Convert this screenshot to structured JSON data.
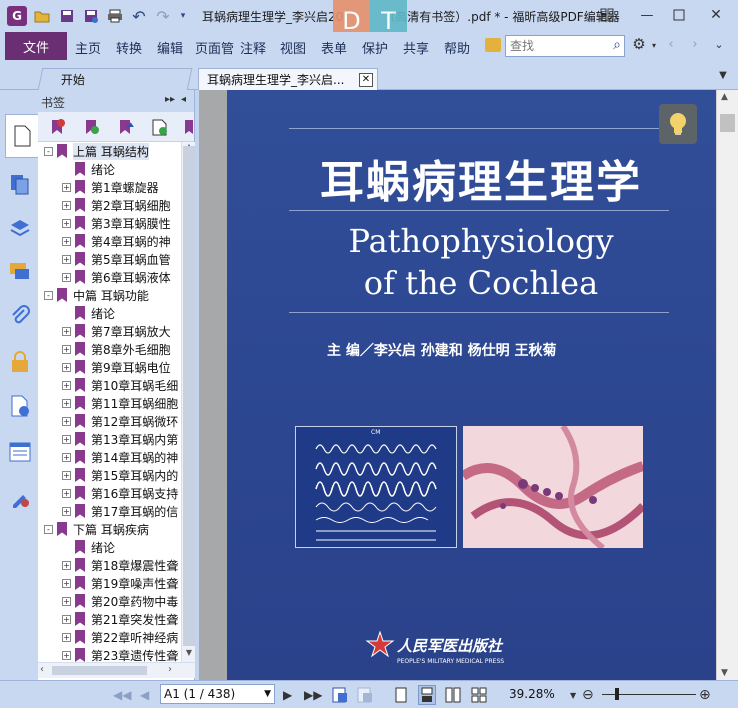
{
  "title_bar": {
    "title": "耳蜗病理生理学_李兴启20",
    "title_suffix": "（高清有书签）.pdf * - 福昕高级PDF编辑器",
    "overlay_left": "D",
    "overlay_right": "T"
  },
  "menu": {
    "file": "文件",
    "items": [
      "主页",
      "转换",
      "编辑",
      "页面管",
      "注释",
      "视图",
      "表单",
      "保护",
      "共享",
      "帮助"
    ],
    "search_placeholder": "查找"
  },
  "tabs": {
    "start": "开始",
    "doc": "耳蜗病理生理学_李兴启..."
  },
  "bookmarks": {
    "header": "书签",
    "items": [
      {
        "label": "上篇  耳蜗结构",
        "level": 0,
        "expander": "-"
      },
      {
        "label": "绪论",
        "level": 1,
        "expander": ""
      },
      {
        "label": "第1章螺旋器",
        "level": 1,
        "expander": "+"
      },
      {
        "label": "第2章耳蜗细胞",
        "level": 1,
        "expander": "+"
      },
      {
        "label": "第3章耳蜗膜性",
        "level": 1,
        "expander": "+"
      },
      {
        "label": "第4章耳蜗的神",
        "level": 1,
        "expander": "+"
      },
      {
        "label": "第5章耳蜗血管",
        "level": 1,
        "expander": "+"
      },
      {
        "label": "第6章耳蜗液体",
        "level": 1,
        "expander": "+"
      },
      {
        "label": "中篇  耳蜗功能",
        "level": 0,
        "expander": "-"
      },
      {
        "label": "绪论",
        "level": 1,
        "expander": ""
      },
      {
        "label": "第7章耳蜗放大",
        "level": 1,
        "expander": "+"
      },
      {
        "label": "第8章外毛细胞",
        "level": 1,
        "expander": "+"
      },
      {
        "label": "第9章耳蜗电位",
        "level": 1,
        "expander": "+"
      },
      {
        "label": "第10章耳蜗毛细",
        "level": 1,
        "expander": "+"
      },
      {
        "label": "第11章耳蜗细胞",
        "level": 1,
        "expander": "+"
      },
      {
        "label": "第12章耳蜗微环",
        "level": 1,
        "expander": "+"
      },
      {
        "label": "第13章耳蜗内第",
        "level": 1,
        "expander": "+"
      },
      {
        "label": "第14章耳蜗的神",
        "level": 1,
        "expander": "+"
      },
      {
        "label": "第15章耳蜗内的",
        "level": 1,
        "expander": "+"
      },
      {
        "label": "第16章耳蜗支持",
        "level": 1,
        "expander": "+"
      },
      {
        "label": "第17章耳蜗的信",
        "level": 1,
        "expander": "+"
      },
      {
        "label": "下篇  耳蜗疾病",
        "level": 0,
        "expander": "-"
      },
      {
        "label": "绪论",
        "level": 1,
        "expander": ""
      },
      {
        "label": "第18章爆震性聋",
        "level": 1,
        "expander": "+"
      },
      {
        "label": "第19章噪声性聋",
        "level": 1,
        "expander": "+"
      },
      {
        "label": "第20章药物中毒",
        "level": 1,
        "expander": "+"
      },
      {
        "label": "第21章突发性聋",
        "level": 1,
        "expander": "+"
      },
      {
        "label": "第22章听神经病",
        "level": 1,
        "expander": "+"
      },
      {
        "label": "第23章遗传性聋",
        "level": 1,
        "expander": "+"
      }
    ]
  },
  "cover": {
    "title_cn": "耳蜗病理生理学",
    "title_en_1": "Pathophysiology",
    "title_en_2": "of the Cochlea",
    "authors": "主  编／李兴启    孙建和    杨仕明    王秋菊",
    "chart_label": "CM",
    "publisher_cn": "人民军医出版社",
    "publisher_en": "PEOPLE'S MILITARY MEDICAL PRESS"
  },
  "status": {
    "page_value": "A1 (1 / 438)",
    "zoom": "39.28%"
  }
}
